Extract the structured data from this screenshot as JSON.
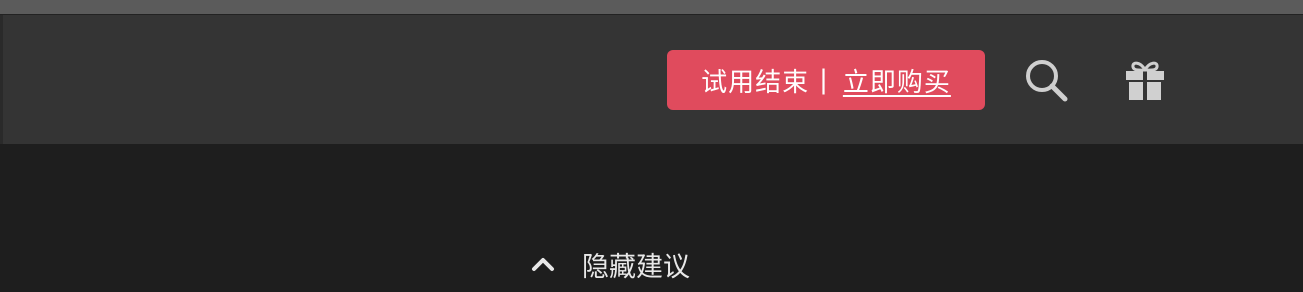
{
  "toolbar": {
    "trial_banner": {
      "status_text": "试用结束",
      "separator": "|",
      "buy_label": "立即购买",
      "color": "#e04b5d"
    },
    "icons": {
      "search": "search-icon",
      "gift": "gift-icon"
    }
  },
  "suggestions": {
    "toggle_label": "隐藏建议",
    "toggle_icon": "chevron-up-icon"
  }
}
